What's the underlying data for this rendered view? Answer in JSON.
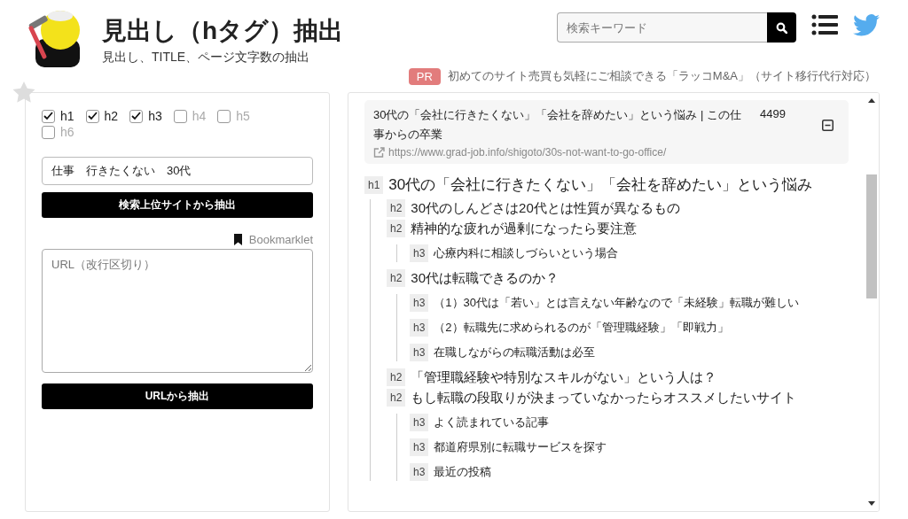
{
  "header": {
    "title": "見出し（hタグ）抽出",
    "subtitle": "見出し、TITLE、ページ文字数の抽出",
    "search": {
      "placeholder": "検索キーワード"
    }
  },
  "ad": {
    "badge": "PR",
    "text": "初めてのサイト売買も気軽にご相談できる「ラッコM&A」（サイト移行代行対応）"
  },
  "form": {
    "levels": [
      {
        "label": "h1",
        "checked": true
      },
      {
        "label": "h2",
        "checked": true
      },
      {
        "label": "h3",
        "checked": true
      },
      {
        "label": "h4",
        "checked": false
      },
      {
        "label": "h5",
        "checked": false
      },
      {
        "label": "h6",
        "checked": false
      }
    ],
    "keyword": {
      "value": "仕事　行きたくない　30代"
    },
    "search_button": "検索上位サイトから抽出",
    "bookmarklet": "Bookmarklet",
    "urls": {
      "placeholder": "URL（改行区切り）"
    },
    "url_button": "URLから抽出"
  },
  "result": {
    "title": "30代の「会社に行きたくない」「会社を辞めたい」という悩み | この仕事からの卒業",
    "count": "4499",
    "url": "https://www.grad-job.info/shigoto/30s-not-want-to-go-office/",
    "expanded": true,
    "headings": [
      {
        "tag": "h1",
        "text": "30代の「会社に行きたくない」「会社を辞めたい」という悩み",
        "children": [
          {
            "tag": "h2",
            "text": "30代のしんどさは20代とは性質が異なるもの"
          },
          {
            "tag": "h2",
            "text": "精神的な疲れが過剰になったら要注意",
            "children": [
              {
                "tag": "h3",
                "text": "心療内科に相談しづらいという場合"
              }
            ]
          },
          {
            "tag": "h2",
            "text": "30代は転職できるのか？",
            "children": [
              {
                "tag": "h3",
                "text": "（1）30代は「若い」とは言えない年齢なので「未経験」転職が難しい"
              },
              {
                "tag": "h3",
                "text": "（2）転職先に求められるのが「管理職経験」「即戦力」"
              },
              {
                "tag": "h3",
                "text": "在職しながらの転職活動は必至"
              }
            ]
          },
          {
            "tag": "h2",
            "text": "「管理職経験や特別なスキルがない」という人は？"
          },
          {
            "tag": "h2",
            "text": "もし転職の段取りが決まっていなかったらオススメしたいサイト",
            "children": [
              {
                "tag": "h3",
                "text": "よく読まれている記事"
              },
              {
                "tag": "h3",
                "text": "都道府県別に転職サービスを探す"
              },
              {
                "tag": "h3",
                "text": "最近の投稿"
              }
            ]
          }
        ]
      }
    ]
  }
}
